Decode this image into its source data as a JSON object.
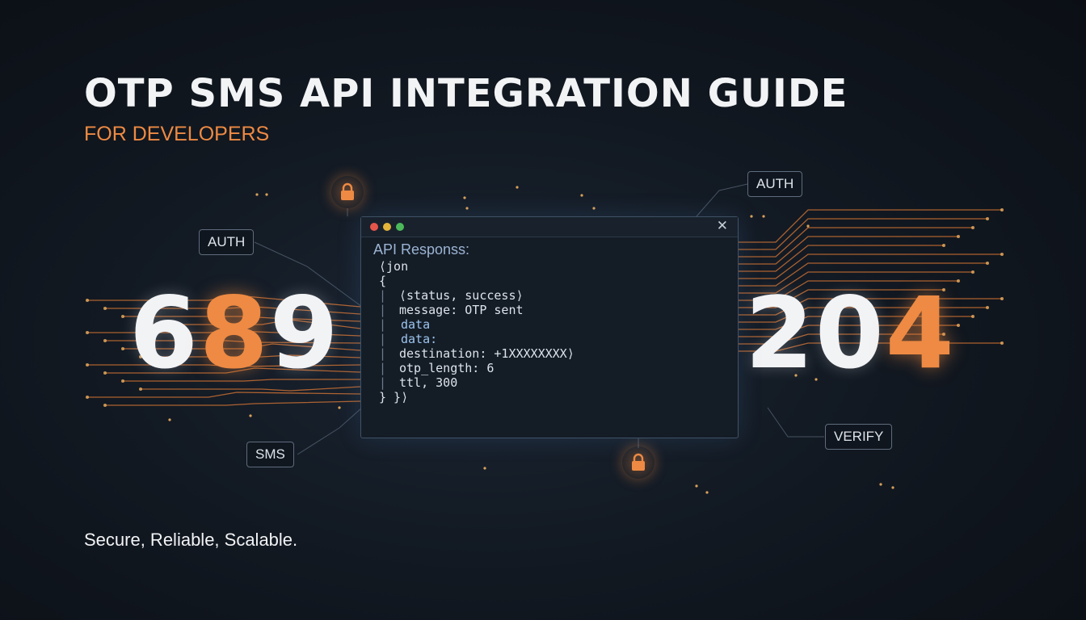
{
  "title": "OTP SMS API INTEGRATION GUIDE",
  "subtitle": "FOR DEVELOPERS",
  "tagline": "Secure, Reliable, Scalable.",
  "tags": {
    "auth_left": "AUTH",
    "auth_right": "AUTH",
    "sms": "SMS",
    "verify": "VERIFY"
  },
  "digits_left": [
    "6",
    "8",
    "9"
  ],
  "digits_right": [
    "2",
    "0",
    "4"
  ],
  "terminal": {
    "heading": "API Responss:",
    "lines": [
      "⟨jon",
      "{",
      "⟨status, success⟩",
      "message: OTP sent",
      "data",
      "data:",
      "destination: +1XXXXXXXX⟩",
      "otp_length: 6",
      "ttl, 300",
      "} }⟩"
    ],
    "close_icon": "close-icon"
  },
  "colors": {
    "accent": "#ee8a43",
    "text": "#f2f3f5",
    "background": "#121922",
    "code_highlight": "#9cc4ee"
  },
  "icons": [
    "lock-icon",
    "close-icon"
  ]
}
